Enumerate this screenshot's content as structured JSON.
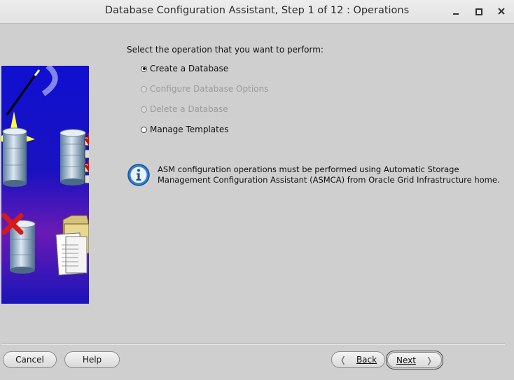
{
  "window": {
    "title": "Database Configuration Assistant, Step 1 of 12 : Operations",
    "controls": [
      "minimize-icon",
      "maximize-icon",
      "close-icon"
    ]
  },
  "main": {
    "prompt": "Select the operation that you want to perform:",
    "options": [
      {
        "label": "Create a Database",
        "selected": true,
        "enabled": true
      },
      {
        "label": "Configure Database Options",
        "selected": false,
        "enabled": false
      },
      {
        "label": "Delete a Database",
        "selected": false,
        "enabled": false
      },
      {
        "label": "Manage Templates",
        "selected": false,
        "enabled": true
      }
    ],
    "info": {
      "icon": "info-icon",
      "line1": "ASM configuration operations must be performed using Automatic Storage",
      "line2": "Management Configuration Assistant (ASMCA) from Oracle Grid Infrastructure home."
    }
  },
  "footer": {
    "cancel_label": "Cancel",
    "help_label": "Help",
    "back_label": "Back",
    "next_label": "Next"
  },
  "colors": {
    "background": "#cfcfcf",
    "panel_blue": "#1414c8",
    "panel_purple": "#6a1ab4",
    "info_blue": "#2f7fd8"
  }
}
